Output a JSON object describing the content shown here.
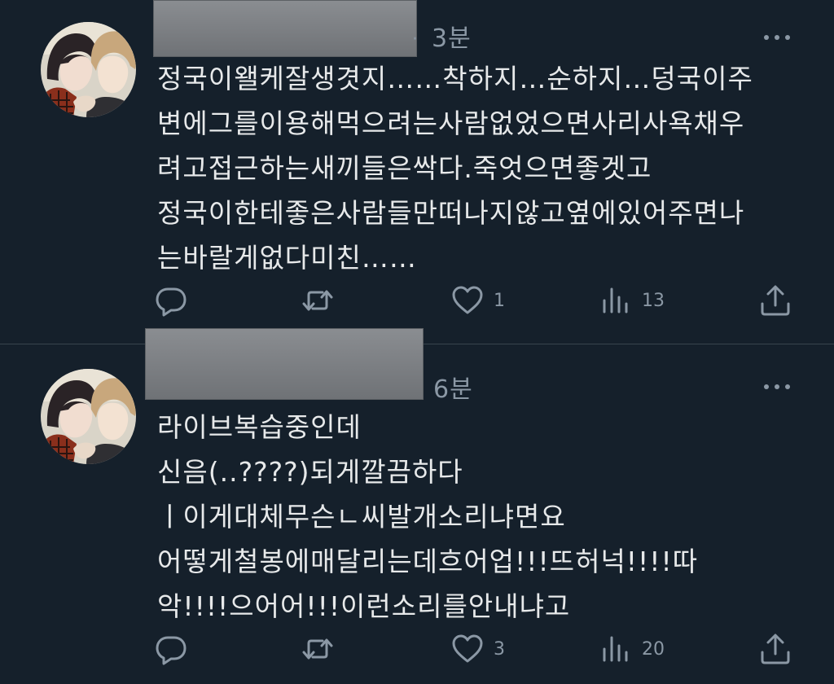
{
  "tweets": [
    {
      "time": "3분",
      "dot": "·",
      "text": "정국이왤케잘생겻지……착하지…순하지…덩국이주\n변에그를이용해먹으려는사람없었으면사리사욕채우\n려고접근하는새끼들은싹다.죽엇으면좋겟고\n정국이한테좋은사람들만떠나지않고옆에있어주면나\n는바랄게없다미친……",
      "actions": {
        "reply_count": "",
        "retweet_count": "",
        "like_count": "1",
        "views_count": "13"
      }
    },
    {
      "time": "6분",
      "dot": "",
      "text": "라이브복습중인데\n신음(..????)되게깔끔하다\n ㅣ이게대체무슨ㄴ씨발개소리냐면요\n어떻게철봉에매달리는데흐어업!!!뜨허넉!!!!따\n악!!!!으어어!!!이런소리를안내냐고",
      "actions": {
        "reply_count": "",
        "retweet_count": "",
        "like_count": "3",
        "views_count": "20"
      }
    }
  ],
  "icons": {
    "avatar": "avatar-image",
    "more": "more-horizontal-icon",
    "reply": "reply-icon",
    "retweet": "retweet-icon",
    "like": "heart-icon",
    "views": "views-icon",
    "share": "share-icon"
  },
  "colors": {
    "background": "#15202b",
    "text": "#e7e9ea",
    "secondary": "#8b98a5",
    "divider": "#38444d",
    "redacted_block": "#7d8084"
  }
}
